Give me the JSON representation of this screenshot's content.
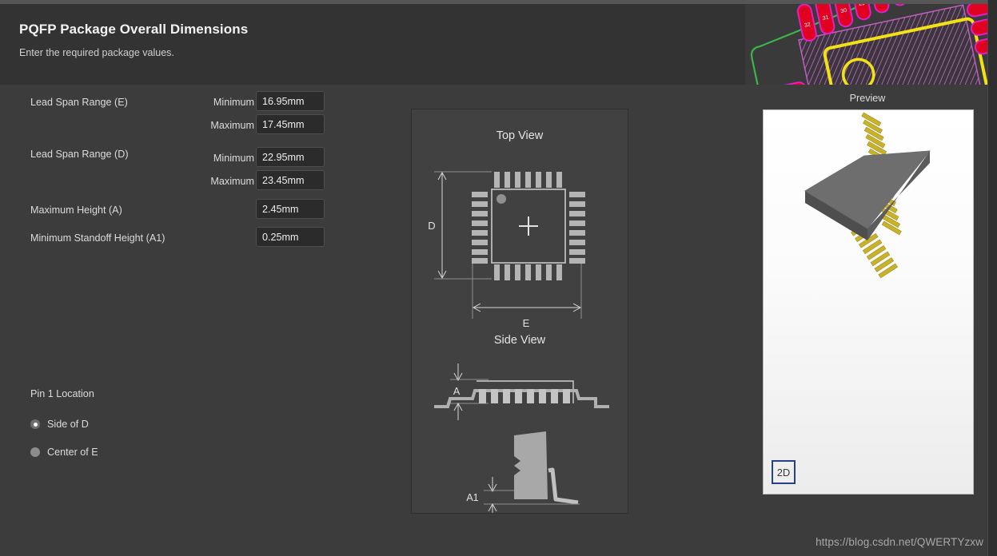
{
  "window": {
    "title": "PQFP Package Overall Dimensions",
    "subtitle": "Enter the required package values."
  },
  "form": {
    "rows": [
      {
        "label": "Lead Span Range (E)",
        "fields": [
          {
            "qualifier": "Minimum",
            "value": "16.95mm",
            "placeholder": "0.00mm"
          },
          {
            "qualifier": "Maximum",
            "value": "17.45mm",
            "placeholder": "0.00mm"
          }
        ]
      },
      {
        "label": "Lead Span Range (D)",
        "fields": [
          {
            "qualifier": "Minimum",
            "value": "22.95mm",
            "placeholder": "0.00mm"
          },
          {
            "qualifier": "Maximum",
            "value": "23.45mm",
            "placeholder": "0.00mm"
          }
        ]
      },
      {
        "label": "Maximum Height (A)",
        "fields": [
          {
            "qualifier": "",
            "value": "2.45mm",
            "placeholder": "0.00mm"
          }
        ]
      },
      {
        "label": "Minimum Standoff Height (A1)",
        "fields": [
          {
            "qualifier": "",
            "value": "0.25mm",
            "placeholder": "0.00mm"
          }
        ]
      }
    ]
  },
  "pin1": {
    "title": "Pin 1 Location",
    "options": [
      {
        "label": "Side of D",
        "selected": true
      },
      {
        "label": "Center of E",
        "selected": false
      }
    ]
  },
  "diagram": {
    "top_view_title": "Top View",
    "side_view_title": "Side View",
    "dimension_d": "D",
    "dimension_e": "E",
    "dimension_a": "A",
    "dimension_a1": "A1"
  },
  "preview": {
    "label": "Preview",
    "toggle_label": "2D"
  },
  "watermark": {
    "text": "https://blog.csdn.net/QWERTYzxw"
  },
  "colors": {
    "window_bg": "#3c3c3c",
    "header_bg": "#333333",
    "field_bg": "#2b2b2b",
    "text": "#dcdcdc",
    "panel_bg": "#414141",
    "pad_red": "#e00020",
    "pad_outline_magenta": "#e020c8",
    "board_green": "#3cb44b",
    "silk_yellow": "#f2e215",
    "lead_gold": "#c9b229",
    "body_gray": "#6e6e6e",
    "accent_blue": "#27408b"
  }
}
